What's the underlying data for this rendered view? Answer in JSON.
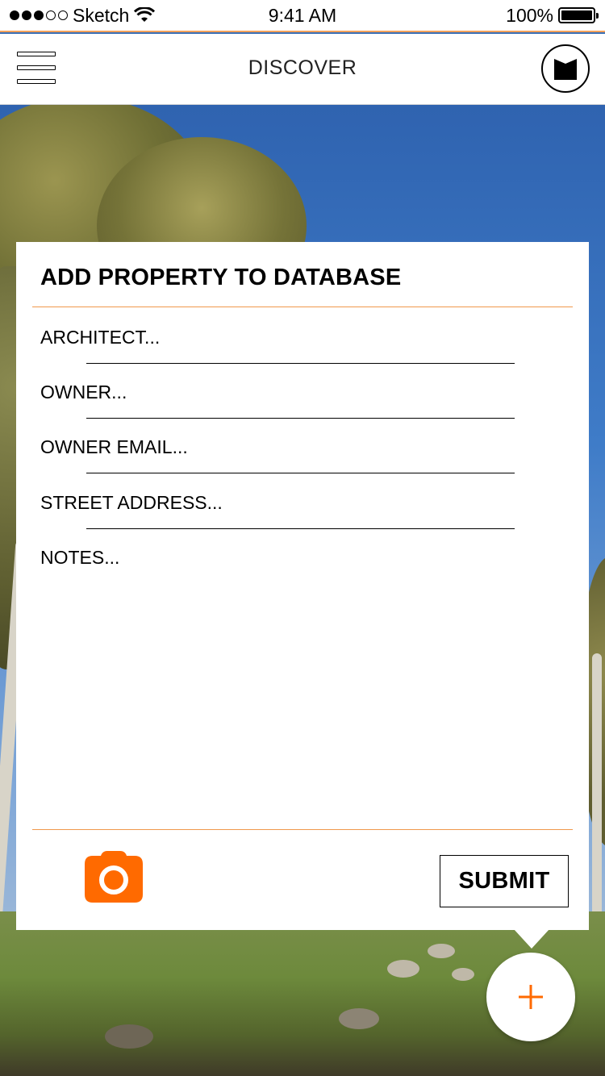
{
  "status_bar": {
    "carrier": "Sketch",
    "time": "9:41 AM",
    "battery": "100%"
  },
  "nav": {
    "title": "DISCOVER"
  },
  "form": {
    "title": "ADD PROPERTY TO DATABASE",
    "fields": [
      {
        "placeholder": "ARCHITECT..."
      },
      {
        "placeholder": "OWNER..."
      },
      {
        "placeholder": "OWNER EMAIL..."
      },
      {
        "placeholder": "STREET ADDRESS..."
      },
      {
        "placeholder": "NOTES..."
      }
    ],
    "submit_label": "SUBMIT"
  },
  "icons": {
    "menu": "hamburger-icon",
    "profile": "logo-icon",
    "camera": "camera-icon",
    "add": "plus-icon"
  },
  "colors": {
    "accent": "#ff6a00",
    "divider": "#f0994c"
  }
}
